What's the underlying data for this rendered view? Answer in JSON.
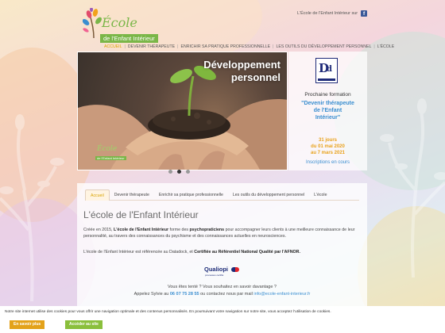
{
  "header": {
    "logo": {
      "title": "École",
      "subtitle": "de l'Enfant Intérieur"
    },
    "top_link": "L'École de l'Enfant Intérieur sur",
    "facebook_icon": "facebook-icon"
  },
  "nav": {
    "items": [
      {
        "label": "ACCUEIL",
        "active": true
      },
      {
        "label": "DEVENIR THÉRAPEUTE"
      },
      {
        "label": "ENRICHIR SA PRATIQUE PROFESSIONNELLE"
      },
      {
        "label": "LES OUTILS DU DÉVELOPPEMENT PERSONNEL"
      },
      {
        "label": "L'ÉCOLE"
      }
    ]
  },
  "slider": {
    "title_line1": "Développement",
    "title_line2": "personnel",
    "logo_title": "École",
    "logo_subtitle": "de l'Enfant Intérieur",
    "current_slide": 2,
    "total_slides": 3
  },
  "promo": {
    "badge": "datadock-logo",
    "kicker": "Prochaine formation",
    "title_lines": [
      "\"Devenir thérapeute",
      "de l'Enfant",
      "Intérieur\""
    ],
    "date_lines": [
      "31 jours",
      "du 01 mai 2020",
      "au 7 mars 2021"
    ],
    "status": "Inscriptions en cours"
  },
  "content": {
    "tabs": [
      {
        "label": "Accueil",
        "active": true
      },
      {
        "label": "Devenir thérapeute"
      },
      {
        "label": "Enrichir sa pratique professionnelle"
      },
      {
        "label": "Les outils du développement personnel"
      },
      {
        "label": "L'école"
      }
    ],
    "heading": "L'école de l'Enfant Intérieur",
    "p1_a": "Créée en 2015,  ",
    "p1_b": "L'école de l'Enfant Intérieur",
    "p1_c": " forme des ",
    "p1_d": "psychopraticiens",
    "p1_e": " pour accompagner leurs clients à une meilleure connaissance de leur personnalité, au travers des connaissances du psychisme et des connaissances actuelles en neurosciences.",
    "p2_a": "L'école de l'Enfant Intérieur est référencée au Datadock, et ",
    "p2_b": "Certifiée au Référentiel National Qualité par l'AFNOR.",
    "qualiopi": {
      "name": "Qualiopi",
      "sub": "processus certifié"
    },
    "cta_line1": "Vous êtes tenté ? Vous souhaitez en savoir davantage ?",
    "cta_line2_a": "Appelez Sylvie au ",
    "phone": "06 07 75 28 55",
    "cta_line2_b": " ou contactez nous par mail ",
    "email": "info@ecole-enfant-interieur.fr"
  },
  "cookie": {
    "text": "Notre site internet utilise des cookies pour vous offrir une navigation optimale et des contenus personnalisés. En poursuivant votre navigation sur notre site, vous acceptez l'utilisation de cookies.",
    "more_label": "En savoir plus",
    "accept_label": "Accéder au site"
  },
  "colors": {
    "accent_green": "#7ab648",
    "accent_orange": "#e8a21b",
    "link_blue": "#3a8ed0"
  }
}
